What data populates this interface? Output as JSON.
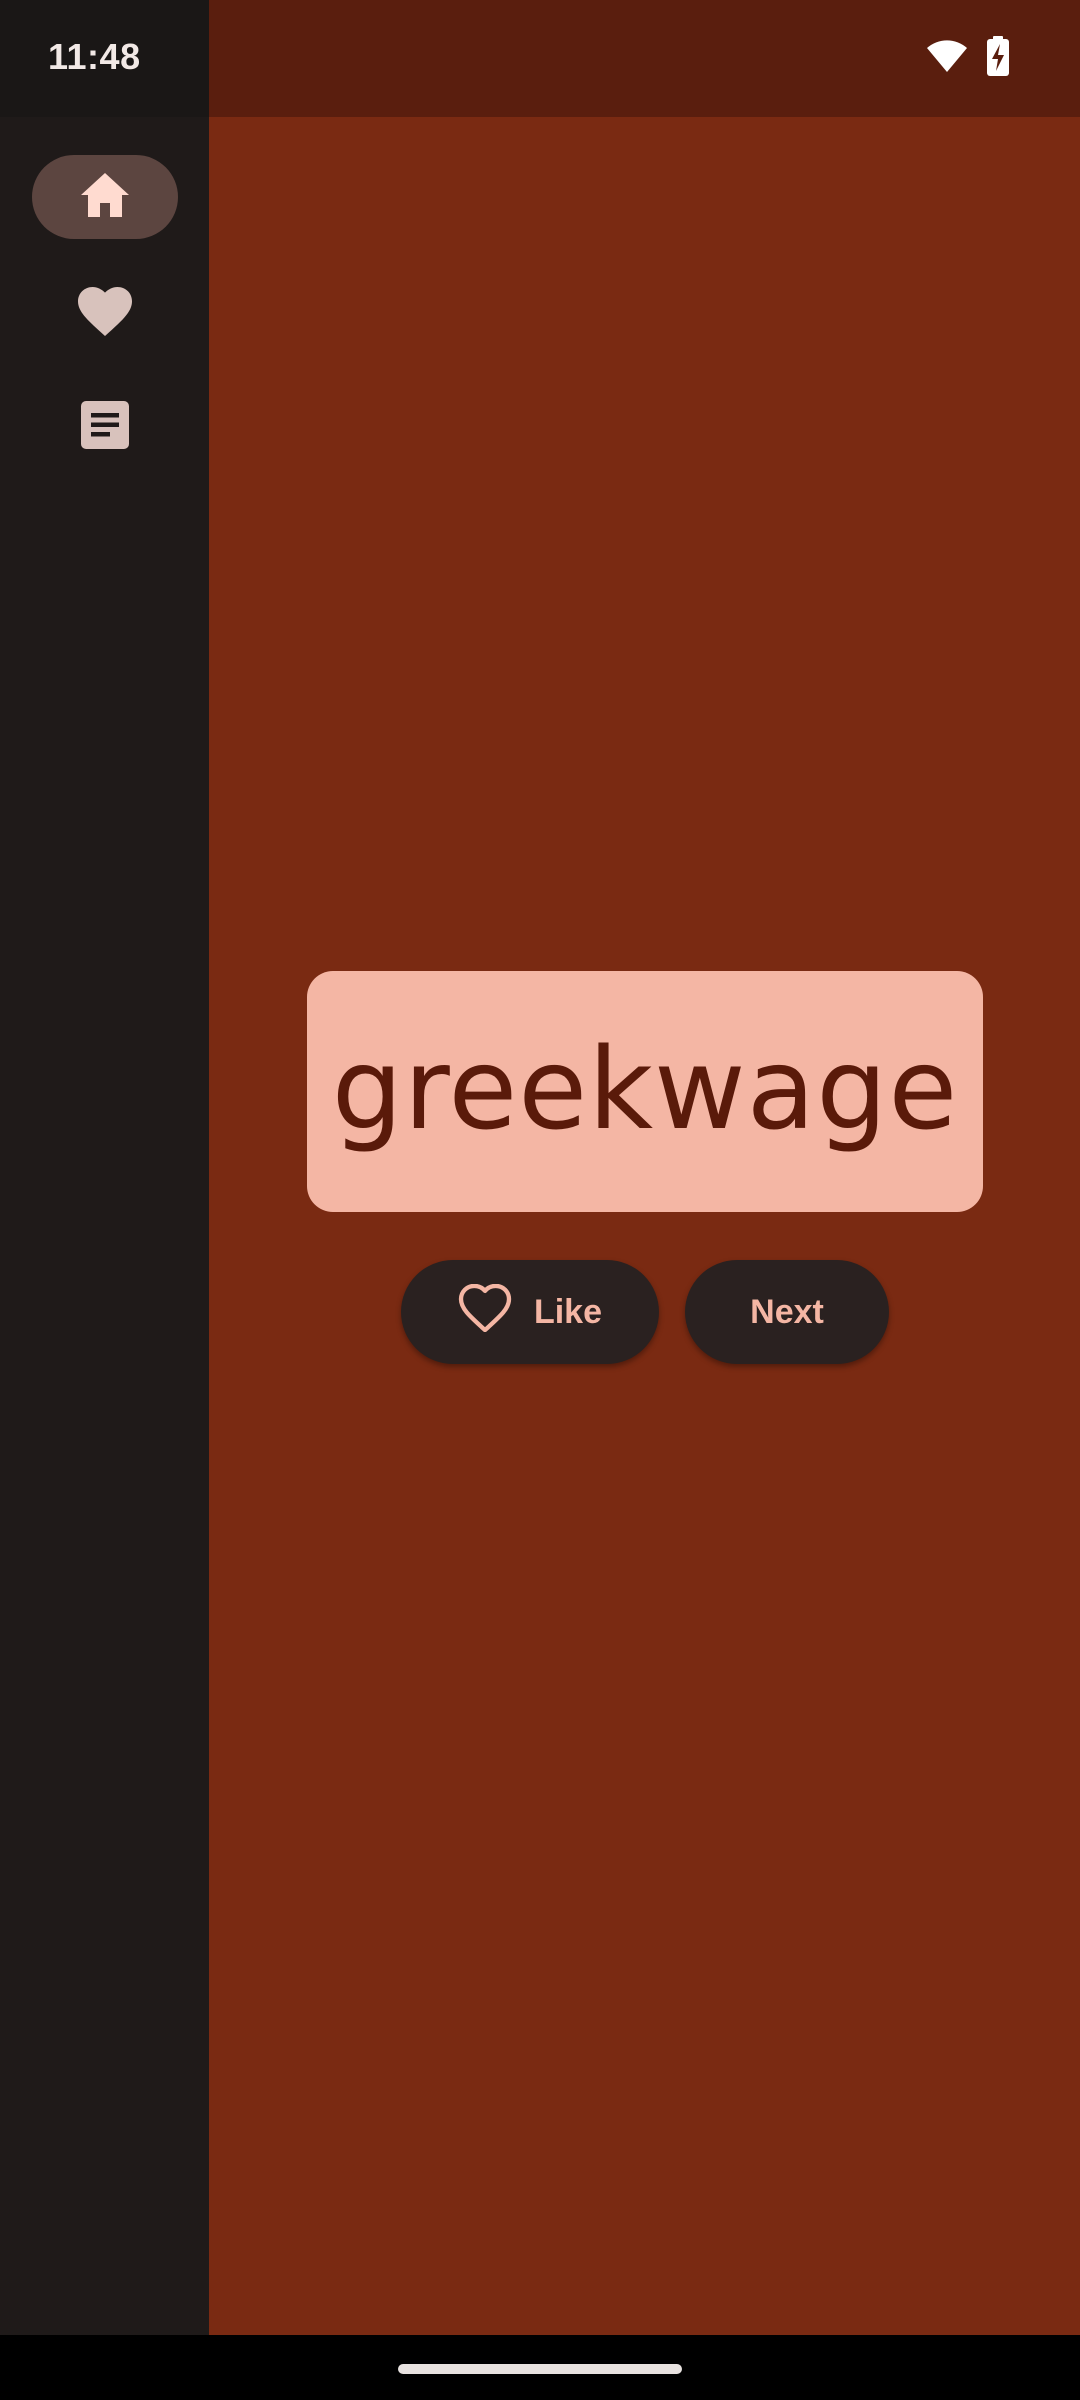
{
  "status_bar": {
    "time": "11:48",
    "icons": [
      "wifi-icon",
      "battery-charging-icon"
    ]
  },
  "nav_rail": {
    "items": [
      {
        "icon": "home-icon",
        "active": true
      },
      {
        "icon": "heart-icon",
        "active": false
      },
      {
        "icon": "article-icon",
        "active": false
      }
    ]
  },
  "main": {
    "word": "greekwage",
    "like_label": "Like",
    "next_label": "Next"
  },
  "colors": {
    "background": "#7a2a12",
    "status_bar": "#5a1e0e",
    "rail": "#1f1a19",
    "card": "#f4b6a4",
    "card_text": "#5a1a0a",
    "button": "#2a2120",
    "button_text": "#f4b6a4",
    "active_indicator": "#5c4540"
  }
}
